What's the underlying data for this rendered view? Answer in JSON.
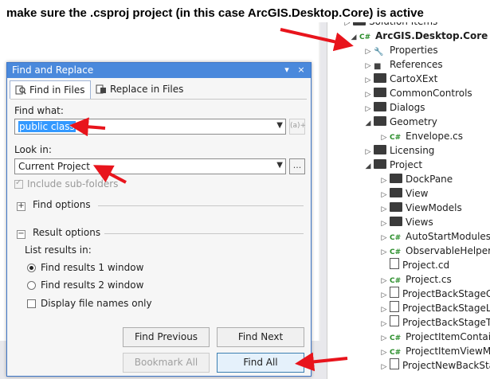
{
  "annotation": "make sure the .csproj project (in this case ArcGIS.Desktop.Core) is active",
  "solution_explorer": {
    "items": [
      {
        "label": "Solution Items",
        "icon": "folder-icon",
        "arrow": "right"
      },
      {
        "label": "ArcGIS.Desktop.Core",
        "icon": "csharp-project-icon",
        "arrow": "down",
        "bold": true
      },
      {
        "label": "Properties",
        "icon": "wrench-icon",
        "arrow": "right"
      },
      {
        "label": "References",
        "icon": "references-icon",
        "arrow": "right"
      },
      {
        "label": "CartoXExt",
        "icon": "folder-icon",
        "arrow": "right"
      },
      {
        "label": "CommonControls",
        "icon": "folder-icon",
        "arrow": "right"
      },
      {
        "label": "Dialogs",
        "icon": "folder-icon",
        "arrow": "right"
      },
      {
        "label": "Geometry",
        "icon": "folder-icon",
        "arrow": "down"
      },
      {
        "label": "Envelope.cs",
        "icon": "csharp-file-icon",
        "arrow": "right"
      },
      {
        "label": "Licensing",
        "icon": "folder-icon",
        "arrow": "right"
      },
      {
        "label": "Project",
        "icon": "folder-icon",
        "arrow": "down"
      },
      {
        "label": "DockPane",
        "icon": "folder-icon",
        "arrow": "right"
      },
      {
        "label": "View",
        "icon": "folder-icon",
        "arrow": "right"
      },
      {
        "label": "ViewModels",
        "icon": "folder-icon",
        "arrow": "right"
      },
      {
        "label": "Views",
        "icon": "folder-icon",
        "arrow": "right"
      },
      {
        "label": "AutoStartModulesP",
        "icon": "csharp-file-icon",
        "arrow": "right"
      },
      {
        "label": "ObservableHelper.c",
        "icon": "csharp-file-icon",
        "arrow": "right"
      },
      {
        "label": "Project.cd",
        "icon": "class-diagram-icon",
        "arrow": ""
      },
      {
        "label": "Project.cs",
        "icon": "csharp-file-icon",
        "arrow": "right"
      },
      {
        "label": "ProjectBackStageGr",
        "icon": "xaml-file-icon",
        "arrow": "right"
      },
      {
        "label": "ProjectBackStageLis",
        "icon": "xaml-file-icon",
        "arrow": "right"
      },
      {
        "label": "ProjectBackStageTe",
        "icon": "xaml-file-icon",
        "arrow": "right"
      },
      {
        "label": "ProjectItemContain",
        "icon": "csharp-file-icon",
        "arrow": "right"
      },
      {
        "label": "ProjectItemViewMo",
        "icon": "csharp-file-icon",
        "arrow": "right"
      },
      {
        "label": "ProjectNewBackSta",
        "icon": "xaml-file-icon",
        "arrow": "right"
      }
    ]
  },
  "dialog": {
    "title": "Find and Replace",
    "tabs": {
      "find_in_files": "Find in Files",
      "replace_in_files": "Replace in Files"
    },
    "find_what_label": "Find what:",
    "find_what_value": "public class",
    "regex_hint": "(a)+",
    "look_in_label": "Look in:",
    "look_in_value": "Current Project",
    "browse_label": "...",
    "include_subfolders": "Include sub-folders",
    "find_options_label": "Find options",
    "result_options_label": "Result options",
    "list_results_label": "List results in:",
    "radio_window1": "Find results 1 window",
    "radio_window2": "Find results 2 window",
    "display_filenames": "Display file names only",
    "buttons": {
      "find_previous": "Find Previous",
      "find_next": "Find Next",
      "bookmark_all": "Bookmark All",
      "find_all": "Find All"
    },
    "pin_glyph": "▾",
    "close_glyph": "×"
  },
  "colors": {
    "titlebar": "#4a89dc",
    "annotation_arrow": "#e8141c",
    "selection": "#3399ff"
  }
}
